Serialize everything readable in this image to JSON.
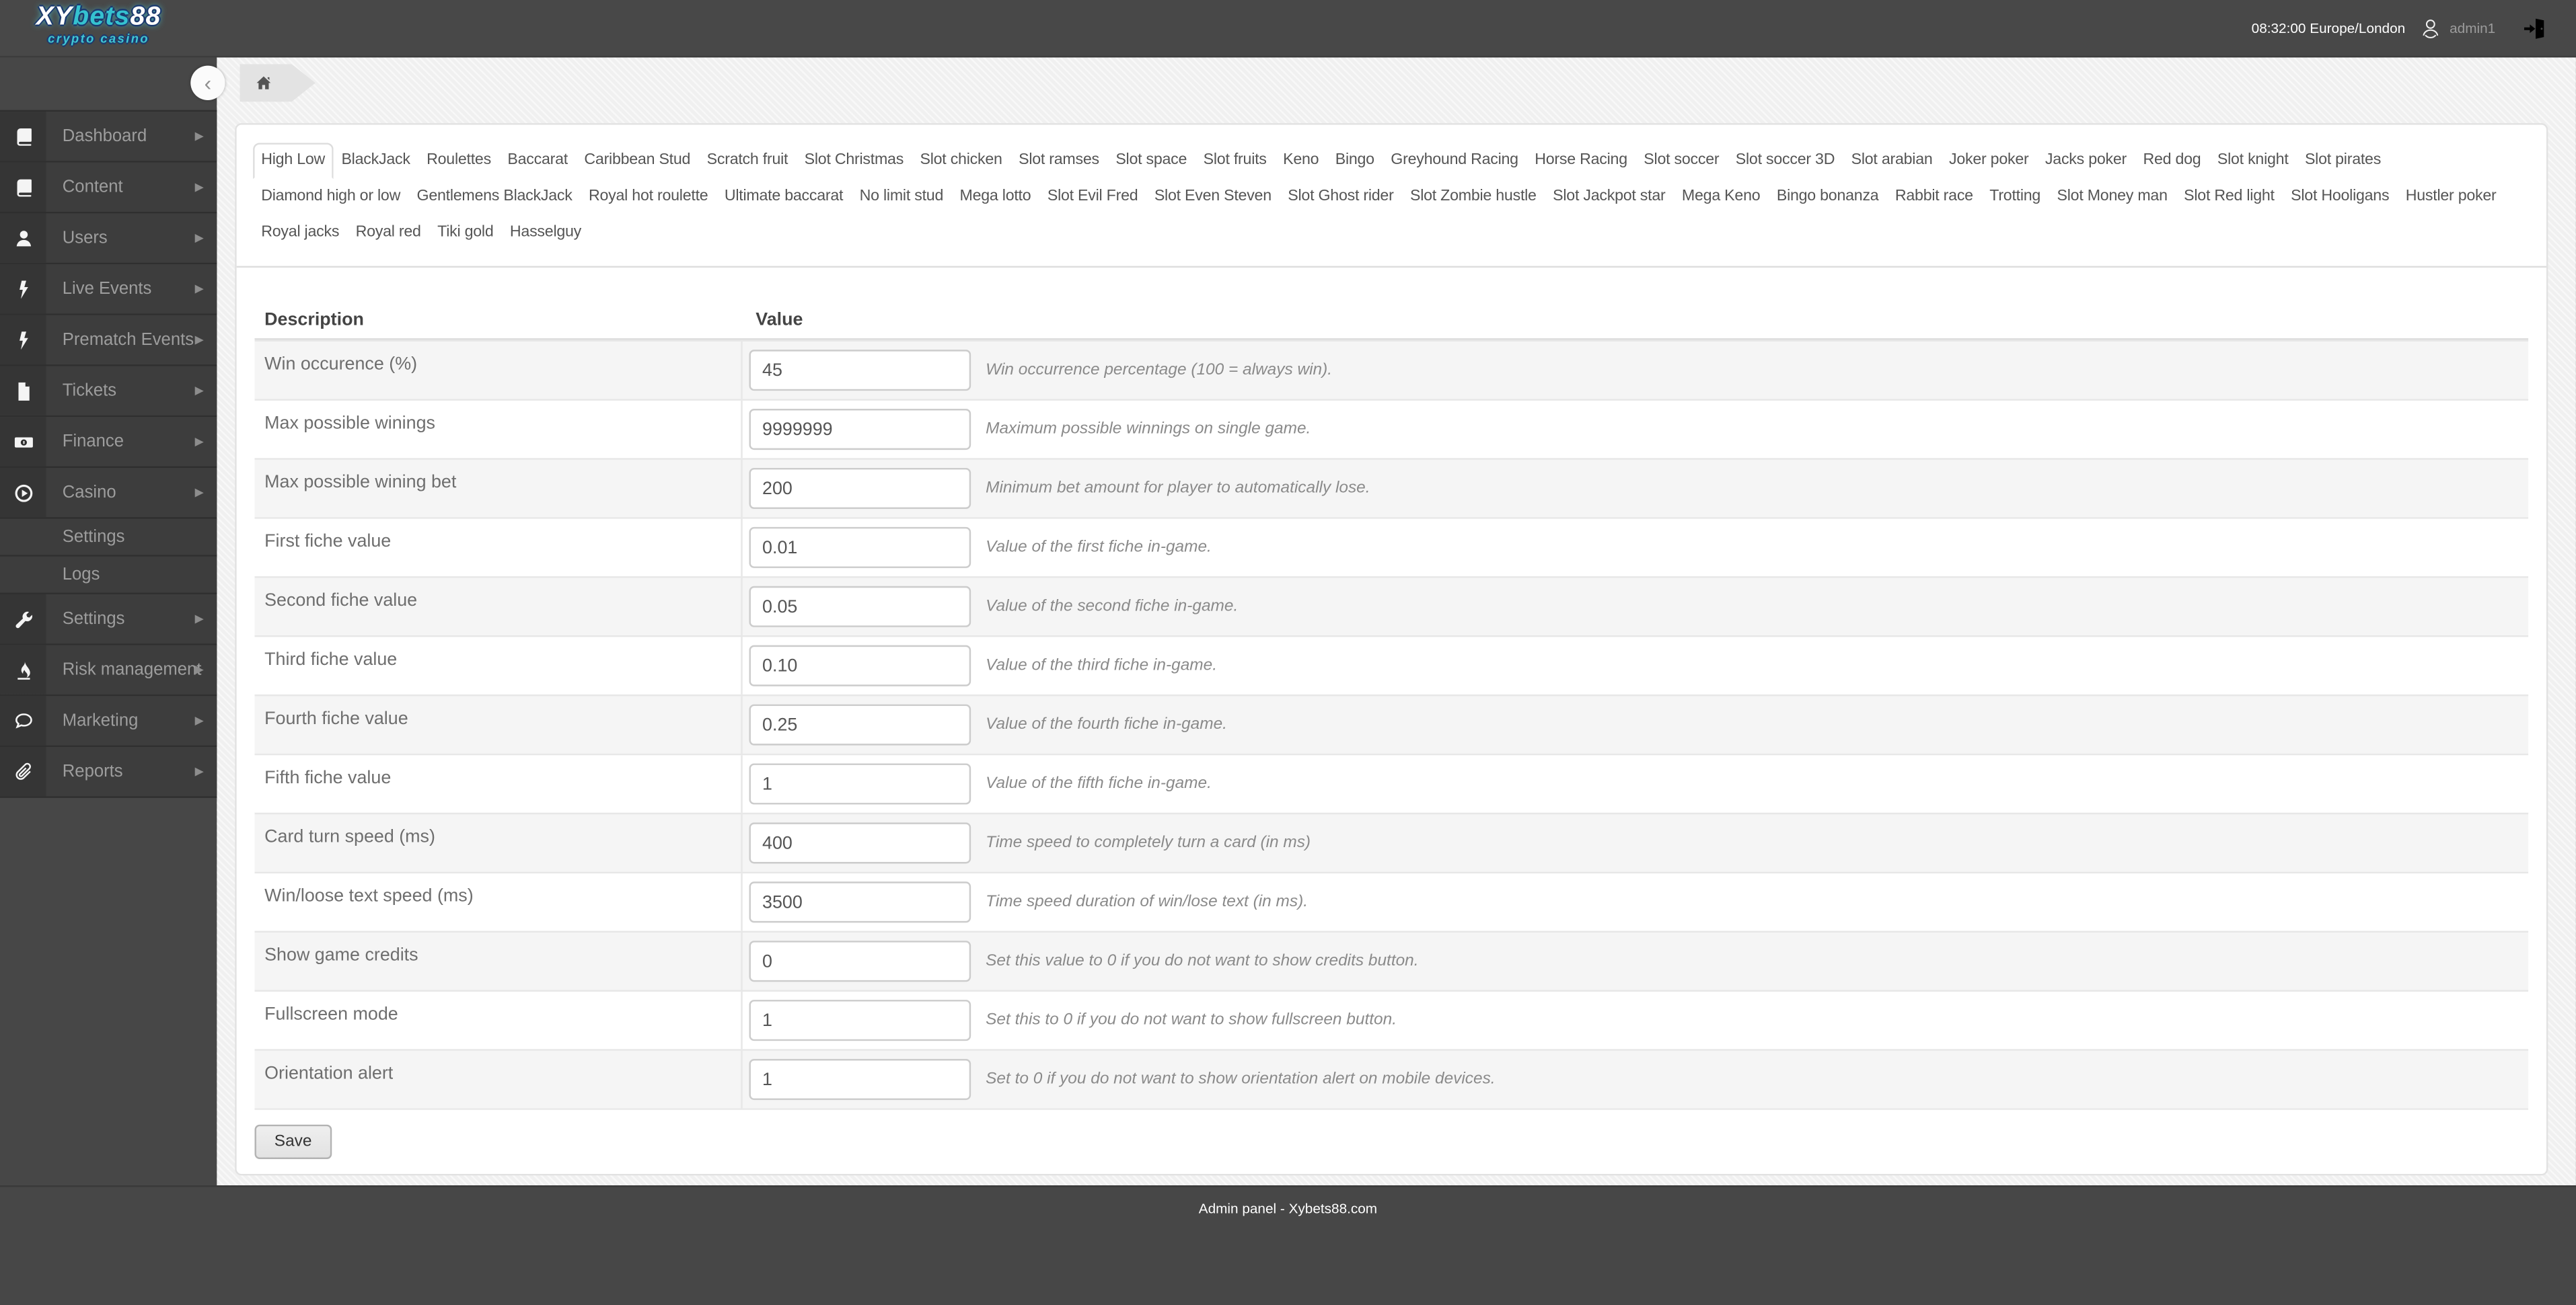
{
  "colors": {
    "topbar_bg": "#484848",
    "sidebar_bg": "#3d3d3d",
    "sidebar_icon_column": "#353535",
    "page_bg": "#f0f0f0",
    "footer_bg": "#474747",
    "logo_teal": "#35c2d0",
    "logo_outline_navy": "#1c3a6e"
  },
  "topbar": {
    "logo": {
      "xy": "XY",
      "bets": "bets",
      "n88": "88",
      "subtitle": "crypto casino"
    },
    "clock": "08:32:00 Europe/London",
    "username": "admin1",
    "icons": [
      "user-avatar-icon",
      "logout-door-icon"
    ]
  },
  "sidebar": {
    "items": [
      {
        "label": "Dashboard",
        "icon": "book"
      },
      {
        "label": "Content",
        "icon": "book"
      },
      {
        "label": "Users",
        "icon": "user"
      },
      {
        "label": "Live Events",
        "icon": "bolt"
      },
      {
        "label": "Prematch Events",
        "icon": "bolt"
      },
      {
        "label": "Tickets",
        "icon": "file"
      },
      {
        "label": "Finance",
        "icon": "money"
      },
      {
        "label": "Casino",
        "icon": "play",
        "submenu": [
          "Settings",
          "Logs"
        ]
      },
      {
        "label": "Settings",
        "icon": "wrench"
      },
      {
        "label": "Risk management",
        "icon": "fire"
      },
      {
        "label": "Marketing",
        "icon": "chat"
      },
      {
        "label": "Reports",
        "icon": "paperclip"
      }
    ]
  },
  "breadcrumb": {
    "home_icon": "home-icon"
  },
  "tabs": {
    "active": "High Low",
    "rows": [
      [
        "High Low",
        "BlackJack",
        "Roulettes",
        "Baccarat",
        "Caribbean Stud",
        "Scratch fruit",
        "Slot Christmas",
        "Slot chicken",
        "Slot ramses",
        "Slot space",
        "Slot fruits",
        "Keno",
        "Bingo",
        "Greyhound Racing",
        "Horse Racing",
        "Slot soccer",
        "Slot soccer 3D",
        "Slot arabian",
        "Joker poker",
        "Jacks poker",
        "Red dog",
        "Slot knight",
        "Slot pirates"
      ],
      [
        "Diamond high or low",
        "Gentlemens BlackJack",
        "Royal hot roulette",
        "Ultimate baccarat",
        "No limit stud",
        "Mega lotto",
        "Slot Evil Fred",
        "Slot Even Steven",
        "Slot Ghost rider",
        "Slot Zombie hustle",
        "Slot Jackpot star",
        "Mega Keno",
        "Bingo bonanza",
        "Rabbit race",
        "Trotting",
        "Slot Money man",
        "Slot Red light",
        "Slot Hooligans",
        "Hustler poker"
      ],
      [
        "Royal jacks",
        "Royal red",
        "Tiki gold",
        "Hasselguy"
      ]
    ]
  },
  "table": {
    "headers": [
      "Description",
      "Value"
    ],
    "rows": [
      {
        "description": "Win occurence (%)",
        "value": "45",
        "hint": "Win occurrence percentage (100 = always win)."
      },
      {
        "description": "Max possible winings",
        "value": "9999999",
        "hint": "Maximum possible winnings on single game."
      },
      {
        "description": "Max possible wining bet",
        "value": "200",
        "hint": "Minimum bet amount for player to automatically lose."
      },
      {
        "description": "First fiche value",
        "value": "0.01",
        "hint": "Value of the first fiche in-game."
      },
      {
        "description": "Second fiche value",
        "value": "0.05",
        "hint": "Value of the second fiche in-game."
      },
      {
        "description": "Third fiche value",
        "value": "0.10",
        "hint": "Value of the third fiche in-game."
      },
      {
        "description": "Fourth fiche value",
        "value": "0.25",
        "hint": "Value of the fourth fiche in-game."
      },
      {
        "description": "Fifth fiche value",
        "value": "1",
        "hint": "Value of the fifth fiche in-game."
      },
      {
        "description": "Card turn speed (ms)",
        "value": "400",
        "hint": "Time speed to completely turn a card (in ms)"
      },
      {
        "description": "Win/loose text speed (ms)",
        "value": "3500",
        "hint": "Time speed duration of win/lose text (in ms)."
      },
      {
        "description": "Show game credits",
        "value": "0",
        "hint": "Set this value to 0 if you do not want to show credits button."
      },
      {
        "description": "Fullscreen mode",
        "value": "1",
        "hint": "Set this to 0 if you do not want to show fullscreen button."
      },
      {
        "description": "Orientation alert",
        "value": "1",
        "hint": "Set to 0 if you do not want to show orientation alert on mobile devices."
      }
    ]
  },
  "save_label": "Save",
  "footer": {
    "text": "Admin panel - Xybets88.com"
  }
}
